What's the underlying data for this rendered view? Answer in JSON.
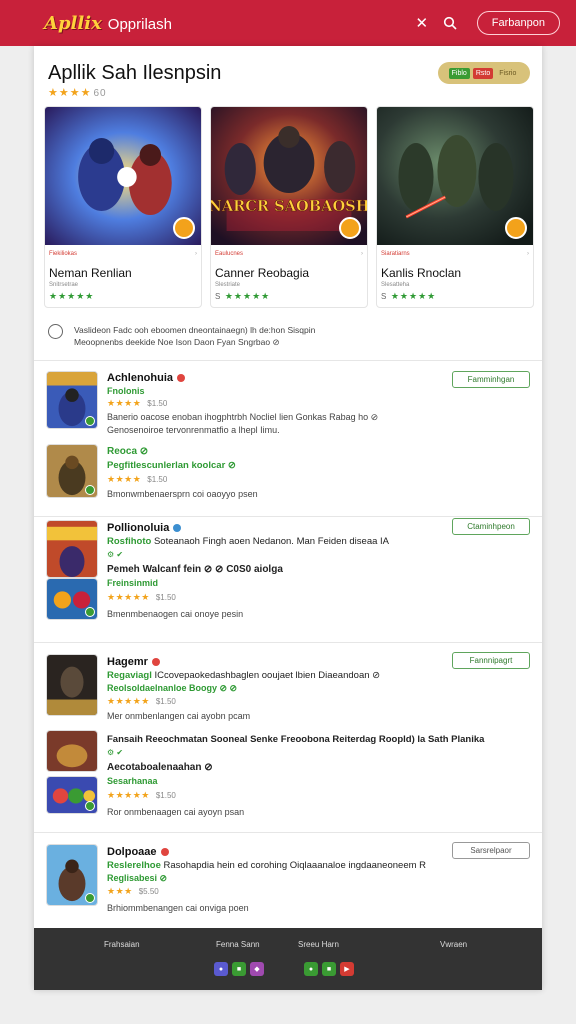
{
  "header": {
    "logo_mark": "Apllix",
    "logo_text": "Opprilash",
    "button_label": "Farbanpon",
    "brand_color": "#c8213a"
  },
  "hero": {
    "title": "Apllik Sah Ilesnpsin",
    "stars": "★★★★",
    "rating_num": "60",
    "tags": [
      "Fiblo",
      "Rsto",
      "Fisrio"
    ]
  },
  "featured": [
    {
      "category": "Fiekiliokas",
      "name": "Neman Renlian",
      "sub": "Snitrsetrae",
      "stars": "★★★★★",
      "rating": ""
    },
    {
      "category": "Eaulucnes",
      "name": "Canner Reobagia",
      "sub": "Slestriate",
      "stars": "★★★★★",
      "rating": "S",
      "image_title": "NARCR SAOBAOSH"
    },
    {
      "category": "Siaratiarns",
      "name": "Kanlis Rnoclan",
      "sub": "Slesatteha",
      "stars": "★★★★★",
      "rating": "S"
    }
  ],
  "notice": {
    "line1": "Vaslideon Fadc ooh eboomen dneontainaegn) lh de:hon Sisqpin",
    "line2": "Meoopnenbs deekide Noe Ison Daon Fyan Sngrbao ⊘"
  },
  "sections": [
    {
      "button": "Famminhgan",
      "items": [
        {
          "name": "Achlenohuia",
          "green": "Fnolonis",
          "stars": "★★★★",
          "rating": "$1.50",
          "desc1": "Banerio oacose enoban ihogphtrbh Nocliel lien Gonkas Rabag ho ⊘",
          "desc2": "Genosenoiroe tervonrenmatfio a lhepl Iimu."
        },
        {
          "name": "Reoca ⊘",
          "green": "Pegfitlescunlerlan koolcar ⊘",
          "stars": "★★★★",
          "rating": "$1.50",
          "desc1": "Bmonwmbenaersprn coi oaoyyo psen"
        }
      ]
    },
    {
      "button": "Ctaminhpeon",
      "items": [
        {
          "name": "Pollionoluia",
          "green": "Rosfihoto",
          "line": "Soteanaoh Fingh aoen Nedanon. Man Feiden diseaa IA",
          "line2": "Pemeh Walcanf fein ⊘ ⊘ C0S0 aiolga",
          "green2": "Freinsinmid",
          "stars": "★★★★★",
          "rating": "$1.50",
          "desc1": "Bmenmbenaogen cai onoye pesin"
        }
      ]
    },
    {
      "button": "Fannnipagrt",
      "items": [
        {
          "name": "Hagemr",
          "green": "Regaviagl",
          "line": "ICcovepaokedashbaglen ooujaet lbien Diaeandoan ⊘",
          "green2": "Reolsoldaelnanloe Boogy ⊘ ⊘",
          "stars": "★★★★★",
          "rating": "$1.50",
          "desc1": "Mer onmbenlangen cai ayobn pcam",
          "line2_r": "Fansaih Reeochmatan Sooneal Senke Freoobona Reiterdag Roopld) la Sath Planika",
          "line3": "Aecotaboalenaahan ⊘",
          "green3": "Sesarhanaa",
          "stars2": "★★★★★",
          "rating2": "$1.50",
          "desc2": "Ror onmbenaagen cai ayoyn psan"
        }
      ]
    },
    {
      "button": "Sarsrelpaor",
      "items": [
        {
          "name": "Dolpoaae",
          "green": "Reslerelhoe",
          "line": "Rasohapdia hein ed corohing Oiqlaaanaloe ingdaaneoneem R",
          "green2": "Reglisabesi ⊘",
          "stars": "★★★",
          "rating": "$5.50",
          "desc1": "Brhiommbenangen cai onviga poen"
        }
      ]
    }
  ],
  "footer": {
    "cols": [
      "Frahsaian",
      "Fenna Sann",
      "Sreeu Harn",
      "Vwraen"
    ]
  }
}
